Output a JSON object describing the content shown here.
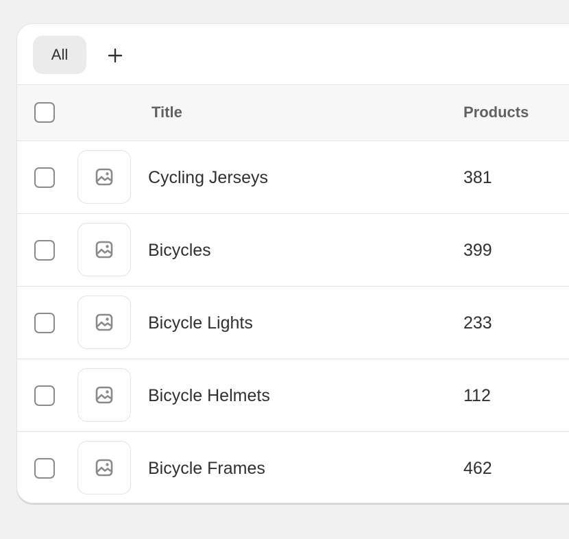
{
  "tabs": {
    "all_label": "All",
    "add_icon": "plus-icon"
  },
  "table": {
    "headers": {
      "title": "Title",
      "products": "Products"
    },
    "image_icon": "image-placeholder-icon",
    "rows": [
      {
        "title": "Cycling Jerseys",
        "products": "381"
      },
      {
        "title": "Bicycles",
        "products": "399"
      },
      {
        "title": "Bicycle Lights",
        "products": "233"
      },
      {
        "title": "Bicycle Helmets",
        "products": "112"
      },
      {
        "title": "Bicycle Frames",
        "products": "462"
      }
    ]
  },
  "colors": {
    "background": "#f1f1f1",
    "card": "#ffffff",
    "header_bg": "#f7f7f7",
    "tab_active_bg": "#ebebeb",
    "border": "#e3e3e3",
    "text": "#303030",
    "muted_text": "#616161",
    "icon": "#8a8a8a"
  }
}
